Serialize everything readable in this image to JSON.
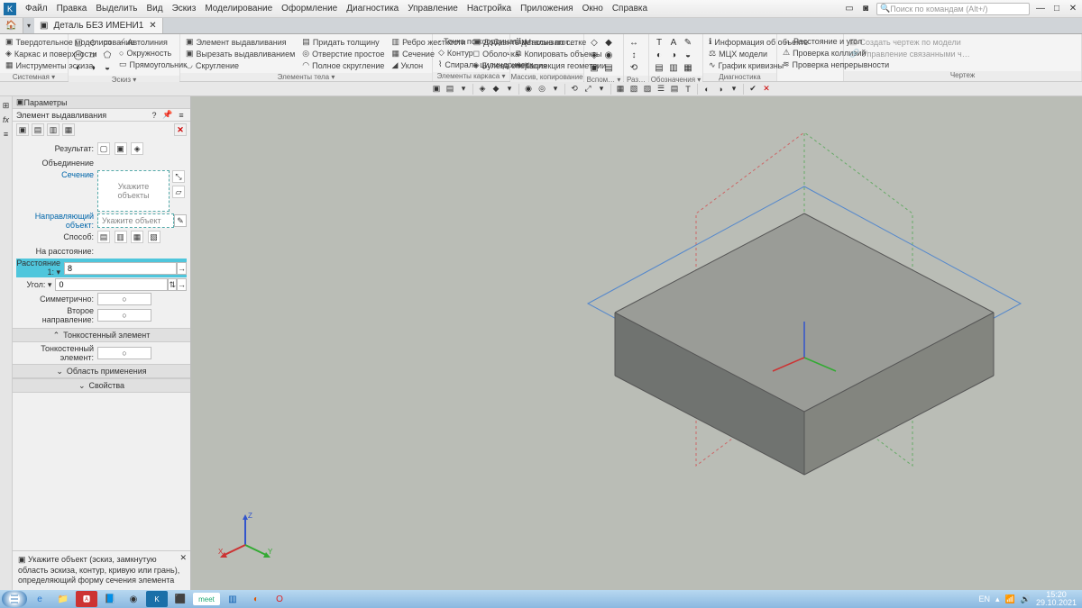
{
  "menu": {
    "items": [
      "Файл",
      "Правка",
      "Выделить",
      "Вид",
      "Эскиз",
      "Моделирование",
      "Оформление",
      "Диагностика",
      "Управление",
      "Настройка",
      "Приложения",
      "Окно",
      "Справка"
    ],
    "search_ph": "Поиск по командам (Alt+/)"
  },
  "tabs": {
    "doc": "Деталь БЕЗ ИМЕНИ1"
  },
  "ribbon": {
    "g1": {
      "r1": "Твердотельное моделирование",
      "r2": "Каркас и поверхности",
      "r3": "Инструменты эскиза",
      "label": "Системная ▾"
    },
    "g2": {
      "r1": "Автолиния",
      "r2": "Окружность",
      "r3": "Прямоугольник",
      "label": "Эскиз ▾"
    },
    "g3": {
      "r1": "Элемент выдавливания",
      "r2": "Вырезать выдавливанием",
      "r3": "Скругление",
      "label": "Элементы тела ▾"
    },
    "g4": {
      "c1r1": "Придать толщину",
      "c1r2": "Отверстие простое",
      "c1r3": "Полное скругление",
      "c2r1": "Ребро жесткости",
      "c2r2": "Сечение",
      "c2r3": "Уклон",
      "c3r1": "Добавить деталь-загот…",
      "c3r2": "Оболочка",
      "c3r3": "Булева операция"
    },
    "g5": {
      "r1": "Точка по координатам",
      "r2": "Контур",
      "r3": "Спираль цилиндрическ…",
      "label": "Элементы каркаса ▾"
    },
    "g6": {
      "r1": "Массив по сетке",
      "r2": "Копировать объекты",
      "r3": "Коллекция геометрии",
      "label": "Массив, копирование ▾"
    },
    "g7": {
      "label": "Вспом… ▾"
    },
    "g8": {
      "label": "Раз… ▾"
    },
    "g9": {
      "r1": "Информация об объекте",
      "r2": "МЦХ модели",
      "r3": "График кривизны",
      "label": "Обозначения ▾"
    },
    "g10": {
      "r1": "Расстояние и угол",
      "r2": "Проверка коллизий",
      "r3": "Проверка непрерывности",
      "label": "Диагностика"
    },
    "g11": {
      "r1": "Создать чертеж по модели",
      "r2": "Управление связанными ч…",
      "label": "Чертеж"
    }
  },
  "panel": {
    "title": "Параметры",
    "subtitle": "Элемент выдавливания",
    "result_label": "Результат:",
    "union_label": "Объединение",
    "section_link": "Сечение",
    "objects_ph": "Укажите объекты",
    "dir_label": "Направляющий объект:",
    "dir_ph": "Укажите объект",
    "method_label": "Способ:",
    "method_sub": "На расстояние:",
    "dist_label": "Расстояние 1: ▾",
    "dist_val": "8",
    "angle_label": "Угол: ▾",
    "angle_val": "0",
    "sym_label": "Симметрично:",
    "dir2_label": "Второе направление:",
    "sec_thin": "Тонкостенный элемент",
    "thin_label": "Тонкостенный элемент:",
    "sec_scope": "Область применения",
    "sec_props": "Свойства",
    "hint": "Укажите объект (эскиз, замкнутую область эскиза, контур, кривую или грань), определяющий форму сечения элемента"
  },
  "tray": {
    "lang": "EN",
    "time": "15:20",
    "date": "29.10.2021",
    "meet": "meet"
  }
}
